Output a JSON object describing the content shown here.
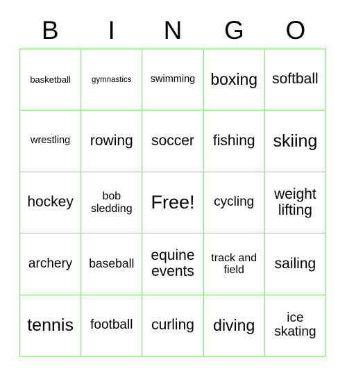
{
  "card": {
    "title_letters": [
      "B",
      "I",
      "N",
      "G",
      "O"
    ],
    "border_color": "#77e866",
    "background_color": "#ffffff",
    "text_color": "#000000",
    "columns": 5,
    "rows": 5,
    "free_space": {
      "row": 3,
      "column": 3,
      "label": "Free!"
    }
  },
  "grid": [
    [
      {
        "label": "basketball",
        "size": "fs-13"
      },
      {
        "label": "gymnastics",
        "size": "fs-11"
      },
      {
        "label": "swimming",
        "size": "fs-14"
      },
      {
        "label": "boxing",
        "size": "fs-23"
      },
      {
        "label": "softball",
        "size": "fs-21"
      }
    ],
    [
      {
        "label": "wrestling",
        "size": "fs-14"
      },
      {
        "label": "rowing",
        "size": "fs-21"
      },
      {
        "label": "soccer",
        "size": "fs-21"
      },
      {
        "label": "fishing",
        "size": "fs-21"
      },
      {
        "label": "skiing",
        "size": "fs-25"
      }
    ],
    [
      {
        "label": "hockey",
        "size": "fs-21"
      },
      {
        "label": "bob sledding",
        "size": "fs-16"
      },
      {
        "label": "Free!",
        "size": "fs-27"
      },
      {
        "label": "cycling",
        "size": "fs-19"
      },
      {
        "label": "weight lifting",
        "size": "fs-21"
      }
    ],
    [
      {
        "label": "archery",
        "size": "fs-19"
      },
      {
        "label": "baseball",
        "size": "fs-17"
      },
      {
        "label": "equine events",
        "size": "fs-21"
      },
      {
        "label": "track and field",
        "size": "fs-16"
      },
      {
        "label": "sailing",
        "size": "fs-21"
      }
    ],
    [
      {
        "label": "tennis",
        "size": "fs-25"
      },
      {
        "label": "football",
        "size": "fs-19"
      },
      {
        "label": "curling",
        "size": "fs-21"
      },
      {
        "label": "diving",
        "size": "fs-23"
      },
      {
        "label": "ice skating",
        "size": "fs-19"
      }
    ]
  ]
}
